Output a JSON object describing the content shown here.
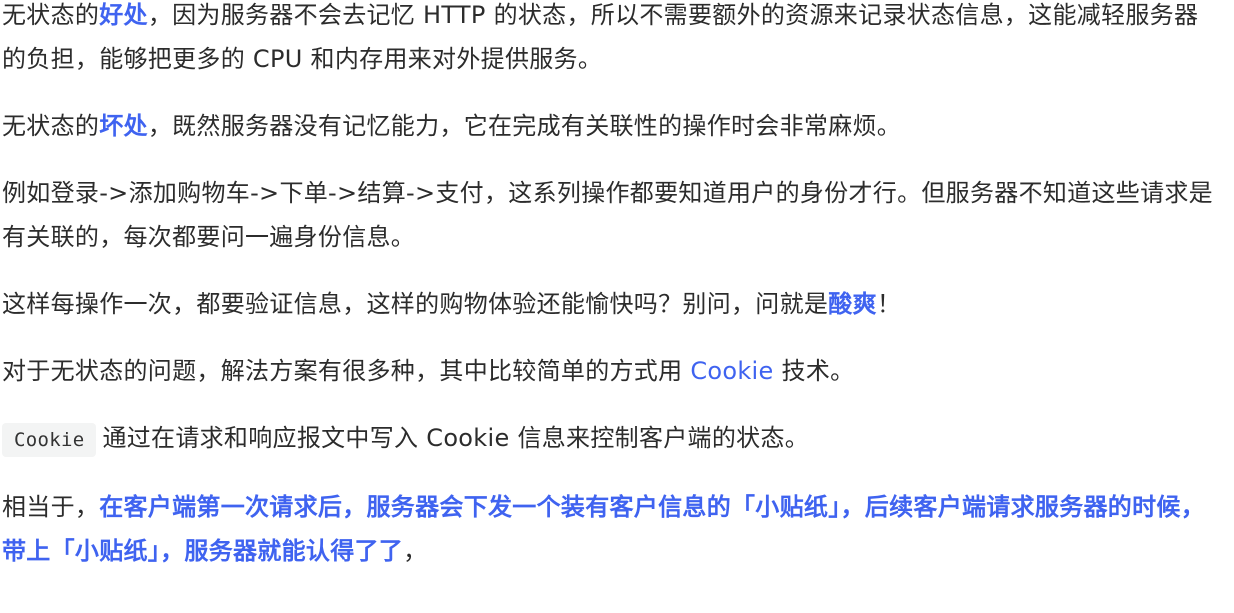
{
  "paragraphs": {
    "p1": {
      "pre": "无状态的",
      "highlight": "好处",
      "post": "，因为服务器不会去记忆 HTTP 的状态，所以不需要额外的资源来记录状态信息，这能减轻服务器的负担，能够把更多的 CPU 和内存用来对外提供服务。"
    },
    "p2": {
      "pre": "无状态的",
      "highlight": "坏处",
      "post": "，既然服务器没有记忆能力，它在完成有关联性的操作时会非常麻烦。"
    },
    "p3": {
      "text": "例如登录->添加购物车->下单->结算->支付，这系列操作都要知道用户的身份才行。但服务器不知道这些请求是有关联的，每次都要问一遍身份信息。"
    },
    "p4": {
      "pre": "这样每操作一次，都要验证信息，这样的购物体验还能愉快吗？别问，问就是",
      "highlight": "酸爽",
      "post": "！"
    },
    "p5": {
      "pre": "对于无状态的问题，解法方案有很多种，其中比较简单的方式用 ",
      "link": "Cookie",
      "post": " 技术。"
    },
    "p6": {
      "code": "Cookie",
      "post": "通过在请求和响应报文中写入 Cookie 信息来控制客户端的状态。"
    },
    "p7": {
      "pre": "相当于，",
      "bold": "在客户端第一次请求后，服务器会下发一个装有客户信息的「小贴纸」，后续客户端请求服务器的时候，带上「小贴纸」，服务器就能认得了了",
      "post": "，"
    }
  },
  "colors": {
    "accent": "#3f63f0",
    "text": "#2c2c2c",
    "code_bg": "#f3f4f4"
  }
}
